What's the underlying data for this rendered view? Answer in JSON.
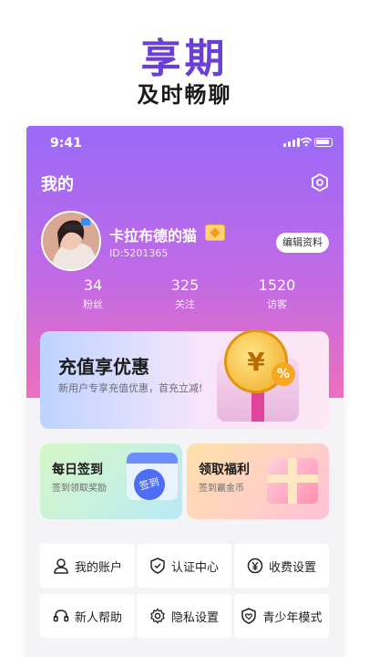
{
  "hero": {
    "title": "享期",
    "subtitle": "及时畅聊"
  },
  "status_bar": {
    "time": "9:41",
    "icons": [
      "signal-icon",
      "wifi-icon",
      "battery-icon"
    ]
  },
  "header": {
    "title": "我的",
    "settings_icon": "hexagon-settings-icon"
  },
  "profile": {
    "username": "卡拉布德的猫",
    "user_id": "ID:5201365",
    "edit_label": "编辑资料",
    "badge_icon": "vip-badge-icon",
    "stats": [
      {
        "value": "34",
        "label": "粉丝"
      },
      {
        "value": "325",
        "label": "关注"
      },
      {
        "value": "1520",
        "label": "访客"
      }
    ]
  },
  "recharge_banner": {
    "title": "充值享优惠",
    "subtitle": "新用户专享充值优惠，首充立减!",
    "coin_symbol": "¥",
    "percent_symbol": "%"
  },
  "cards": [
    {
      "title": "每日签到",
      "subtitle": "签到领取奖励",
      "stamp_text": "签到"
    },
    {
      "title": "领取福利",
      "subtitle": "签到赢金币"
    }
  ],
  "menu": [
    {
      "label": "我的账户",
      "icon": "user-icon"
    },
    {
      "label": "认证中心",
      "icon": "shield-check-icon"
    },
    {
      "label": "收费设置",
      "icon": "yen-circle-icon"
    },
    {
      "label": "新人帮助",
      "icon": "headset-icon"
    },
    {
      "label": "隐私设置",
      "icon": "gear-icon"
    },
    {
      "label": "青少年模式",
      "icon": "shield-heart-icon"
    }
  ],
  "colors": {
    "brand": "#6a3fd6",
    "gradient_top": "#9a6af7",
    "gradient_bottom": "#ee6fbd"
  }
}
